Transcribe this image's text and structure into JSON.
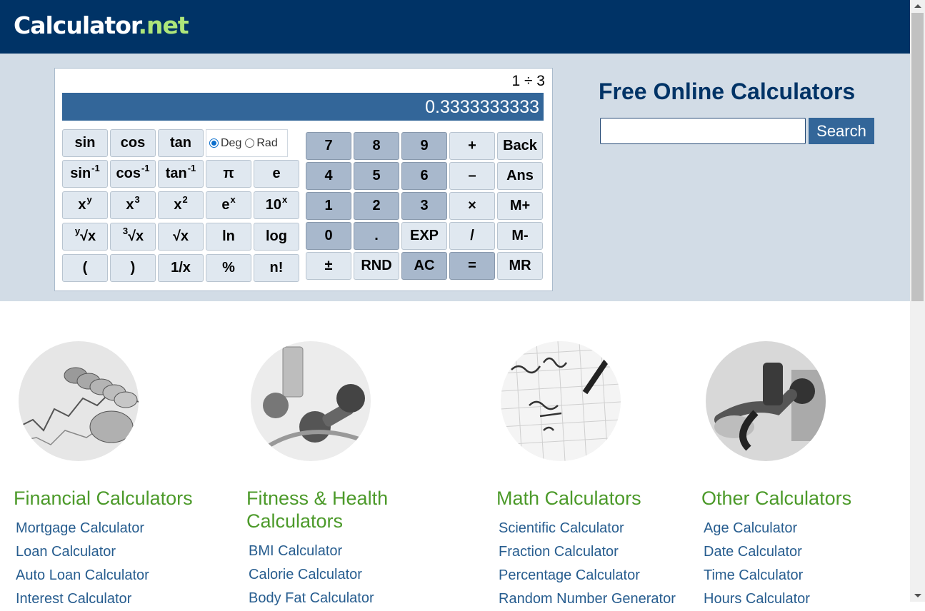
{
  "brand": {
    "name": "Calculator",
    "dot": ".",
    "tld": "net"
  },
  "calculator": {
    "expression": "1 ÷ 3",
    "result": "0.3333333333",
    "angle_modes": {
      "deg": "Deg",
      "rad": "Rad",
      "selected": "Deg"
    },
    "sci": {
      "sin": "sin",
      "cos": "cos",
      "tan": "tan",
      "asin": "sin",
      "acos": "cos",
      "atan": "tan",
      "inv_sup": "-1",
      "pi": "π",
      "e": "e",
      "x": "x",
      "sup_y": "y",
      "sup_3": "3",
      "sup_2": "2",
      "e_base": "e",
      "sup_x": "x",
      "ten": "10",
      "yroot_pre": "y",
      "root3_pre": "3",
      "root": "√x",
      "ln": "ln",
      "log": "log",
      "lparen": "(",
      "rparen": ")",
      "recip": "1/x",
      "percent": "%",
      "fact": "n!"
    },
    "keys": {
      "d7": "7",
      "d8": "8",
      "d9": "9",
      "plus": "+",
      "back": "Back",
      "d4": "4",
      "d5": "5",
      "d6": "6",
      "minus": "–",
      "ans": "Ans",
      "d1": "1",
      "d2": "2",
      "d3": "3",
      "times": "×",
      "mplus": "M+",
      "d0": "0",
      "dot": ".",
      "exp": "EXP",
      "divide": "/",
      "mminus": "M-",
      "plusminus": "±",
      "rnd": "RND",
      "ac": "AC",
      "equals": "=",
      "mr": "MR"
    }
  },
  "search": {
    "title": "Free Online Calculators",
    "placeholder": "",
    "button": "Search"
  },
  "categories": [
    {
      "icon": "coins-chart-image",
      "title": "Financial Calculators",
      "links": [
        "Mortgage Calculator",
        "Loan Calculator",
        "Auto Loan Calculator",
        "Interest Calculator"
      ]
    },
    {
      "icon": "fitness-dumbbell-image",
      "title_line1": "Fitness & Health",
      "title_line2": "Calculators",
      "links": [
        "BMI Calculator",
        "Calorie Calculator",
        "Body Fat Calculator"
      ]
    },
    {
      "icon": "math-paper-image",
      "title": "Math Calculators",
      "links": [
        "Scientific Calculator",
        "Fraction Calculator",
        "Percentage Calculator",
        "Random Number Generator"
      ]
    },
    {
      "icon": "fuel-pump-image",
      "title": "Other Calculators",
      "links": [
        "Age Calculator",
        "Date Calculator",
        "Time Calculator",
        "Hours Calculator"
      ]
    }
  ],
  "colors": {
    "header": "#003366",
    "band": "#d2dce6",
    "display": "#336699",
    "category_title": "#4c9a2a",
    "link": "#275d8f"
  }
}
